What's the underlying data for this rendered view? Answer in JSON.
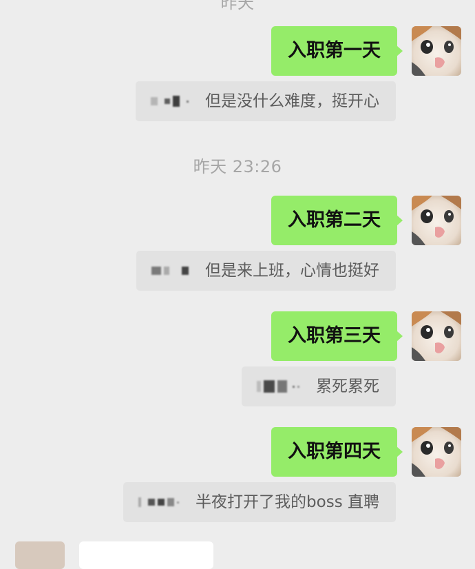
{
  "timestamps": {
    "top_partial": "昨天",
    "middle": "昨天 23:26"
  },
  "messages": [
    {
      "sent_text": "入职第一天",
      "quote_text": "但是没什么难度，挺开心"
    },
    {
      "sent_text": "入职第二天",
      "quote_text": "但是来上班，心情也挺好"
    },
    {
      "sent_text": "入职第三天",
      "quote_text": "累死累死"
    },
    {
      "sent_text": "入职第四天",
      "quote_text": "半夜打开了我的boss 直聘"
    }
  ],
  "colors": {
    "background": "#ededed",
    "sent_bubble": "#95ec69",
    "quote_bubble": "#e2e2e2",
    "timestamp_text": "#a6a6a6"
  },
  "icons": {
    "avatar": "cat-avatar-icon"
  }
}
